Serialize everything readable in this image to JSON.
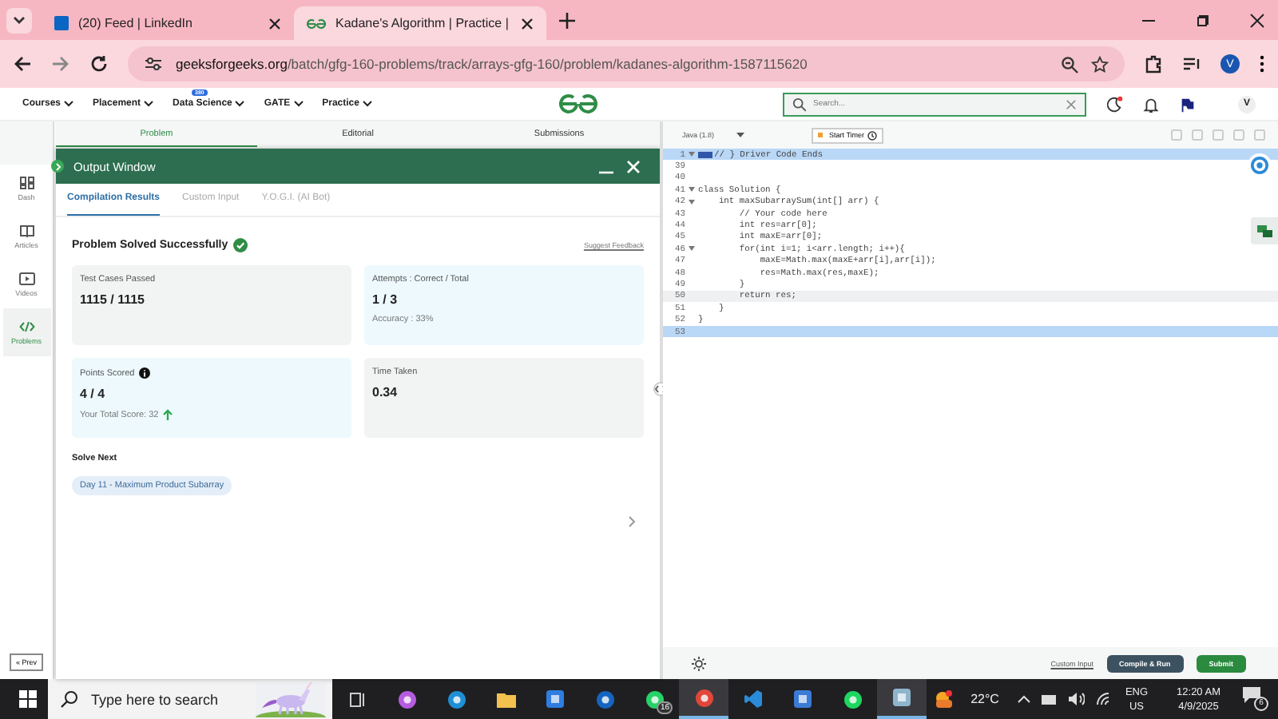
{
  "browser": {
    "tabs": [
      {
        "title": "(20) Feed | LinkedIn",
        "kind": "linkedin",
        "selected": false
      },
      {
        "title": "Kadane's Algorithm | Practice |",
        "kind": "gfg",
        "selected": true
      }
    ],
    "url_host": "geeksforgeeks.org",
    "url_path": "/batch/gfg-160-problems/track/arrays-gfg-160/problem/kadanes-algorithm-1587115620",
    "profile": "V"
  },
  "site_nav": {
    "items": [
      {
        "label": "Courses"
      },
      {
        "label": "Placement"
      },
      {
        "label": "Data Science",
        "badge": "380"
      },
      {
        "label": "GATE"
      },
      {
        "label": "Practice"
      }
    ],
    "search_placeholder": "Search...",
    "avatar": "V"
  },
  "problem_tabs": [
    {
      "label": "Problem",
      "selected": true
    },
    {
      "label": "Editorial",
      "selected": false
    },
    {
      "label": "Submissions",
      "selected": false
    }
  ],
  "sidebar": {
    "items": [
      {
        "label": "Dash",
        "kind": "dash",
        "selected": false
      },
      {
        "label": "Articles",
        "kind": "articles",
        "selected": false
      },
      {
        "label": "Videos",
        "kind": "videos",
        "selected": false
      },
      {
        "label": "Problems",
        "kind": "problems",
        "selected": true
      }
    ],
    "prev_button": "« Prev"
  },
  "output_window": {
    "title": "Output Window",
    "tabs": [
      {
        "label": "Compilation Results",
        "selected": true
      },
      {
        "label": "Custom Input",
        "selected": false
      },
      {
        "label": "Y.O.G.I. (AI Bot)",
        "selected": false
      }
    ],
    "heading": "Problem Solved Successfully",
    "feedback_link": "Suggest Feedback",
    "stats": [
      {
        "label": "Test Cases Passed",
        "value": "1115 / 1115",
        "color": "#f1f4f3"
      },
      {
        "label": "Attempts : Correct / Total",
        "value": "1 / 3",
        "note": "Accuracy : 33%",
        "color": "#edf9fd"
      },
      {
        "label": "Points Scored",
        "value": "4 / 4",
        "note": "Your Total Score: 32",
        "info": true,
        "trend": true,
        "color": "#edf9fd"
      },
      {
        "label": "Time Taken",
        "value": "0.34",
        "color": "#f1f4f3"
      }
    ],
    "solve_next_heading": "Solve Next",
    "next_problem": "Day 11 - Maximum Product Subarray"
  },
  "editor": {
    "language": "Java (1.8)",
    "timer": "Start Timer",
    "lines": [
      {
        "number": "1",
        "code": "// } Driver Code Ends",
        "fold": true,
        "selected": true,
        "current": false,
        "tag": true
      },
      {
        "number": "39",
        "fold": false,
        "selected": false,
        "current": false
      },
      {
        "number": "40",
        "fold": false,
        "selected": false,
        "current": false
      },
      {
        "number": "41",
        "code": "class Solution {",
        "fold": true,
        "selected": false,
        "current": false
      },
      {
        "number": "42",
        "code": "    int maxSubarraySum(int[] arr) {",
        "fold": true,
        "selected": false,
        "current": false
      },
      {
        "number": "43",
        "code": "        // Your code here",
        "fold": false,
        "selected": false,
        "current": false
      },
      {
        "number": "44",
        "code": "        int res=arr[0];",
        "fold": false,
        "selected": false,
        "current": false
      },
      {
        "number": "45",
        "code": "        int maxE=arr[0];",
        "fold": false,
        "selected": false,
        "current": false
      },
      {
        "number": "46",
        "code": "        for(int i=1; i<arr.length; i++){",
        "fold": true,
        "selected": false,
        "current": false
      },
      {
        "number": "47",
        "code": "            maxE=Math.max(maxE+arr[i],arr[i]);",
        "fold": false,
        "selected": false,
        "current": false
      },
      {
        "number": "48",
        "code": "            res=Math.max(res,maxE);",
        "fold": false,
        "selected": false,
        "current": false
      },
      {
        "number": "49",
        "code": "        }",
        "fold": false,
        "selected": false,
        "current": false
      },
      {
        "number": "50",
        "code": "        return res;",
        "fold": false,
        "selected": false,
        "current": true
      },
      {
        "number": "51",
        "code": "    }",
        "fold": false,
        "selected": false,
        "current": false
      },
      {
        "number": "52",
        "code": "}",
        "fold": false,
        "selected": false,
        "current": false
      },
      {
        "number": "53",
        "fold": false,
        "selected": true,
        "current": false
      }
    ],
    "custom_input": "Custom Input",
    "compile_button": "Compile & Run",
    "submit_button": "Submit"
  },
  "taskbar": {
    "search_placeholder": "Type here to search",
    "apps": [
      {
        "kind": "taskview",
        "selected": false
      },
      {
        "kind": "copilot",
        "selected": false
      },
      {
        "kind": "edge",
        "selected": false
      },
      {
        "kind": "folder",
        "selected": false
      },
      {
        "kind": "store",
        "selected": false
      },
      {
        "kind": "outlook",
        "selected": false
      },
      {
        "kind": "whatsapp",
        "selected": false,
        "badge": "16"
      },
      {
        "kind": "chrome",
        "selected": true
      },
      {
        "kind": "vscode",
        "selected": false
      },
      {
        "kind": "window",
        "selected": false
      },
      {
        "kind": "spotify",
        "selected": false
      },
      {
        "kind": "notes",
        "selected": true
      }
    ],
    "weather": "22°C",
    "lang": "ENG",
    "region": "US",
    "time": "12:20 AM",
    "date": "4/9/2025",
    "notifications": "6"
  }
}
